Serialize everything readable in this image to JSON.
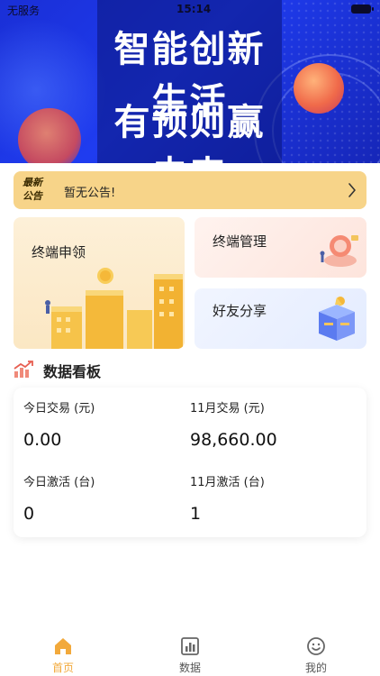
{
  "status_bar": {
    "carrier": "无服务",
    "time": "15:14"
  },
  "banner": {
    "line1": "智能创新生活",
    "line2": "有预则赢未来"
  },
  "notice": {
    "tag": "最新公告",
    "text": "暂无公告!"
  },
  "cards": {
    "apply": "终端申领",
    "manage": "终端管理",
    "share": "好友分享"
  },
  "dashboard": {
    "title": "数据看板",
    "today_trade_label": "今日交易 (元)",
    "today_trade_value": "0.00",
    "month_trade_label": "11月交易 (元)",
    "month_trade_value": "98,660.00",
    "today_activate_label": "今日激活 (台)",
    "today_activate_value": "0",
    "month_activate_label": "11月激活 (台)",
    "month_activate_value": "1"
  },
  "tabbar": {
    "home": "首页",
    "data": "数据",
    "mine": "我的",
    "active_color": "#f2a93b"
  }
}
